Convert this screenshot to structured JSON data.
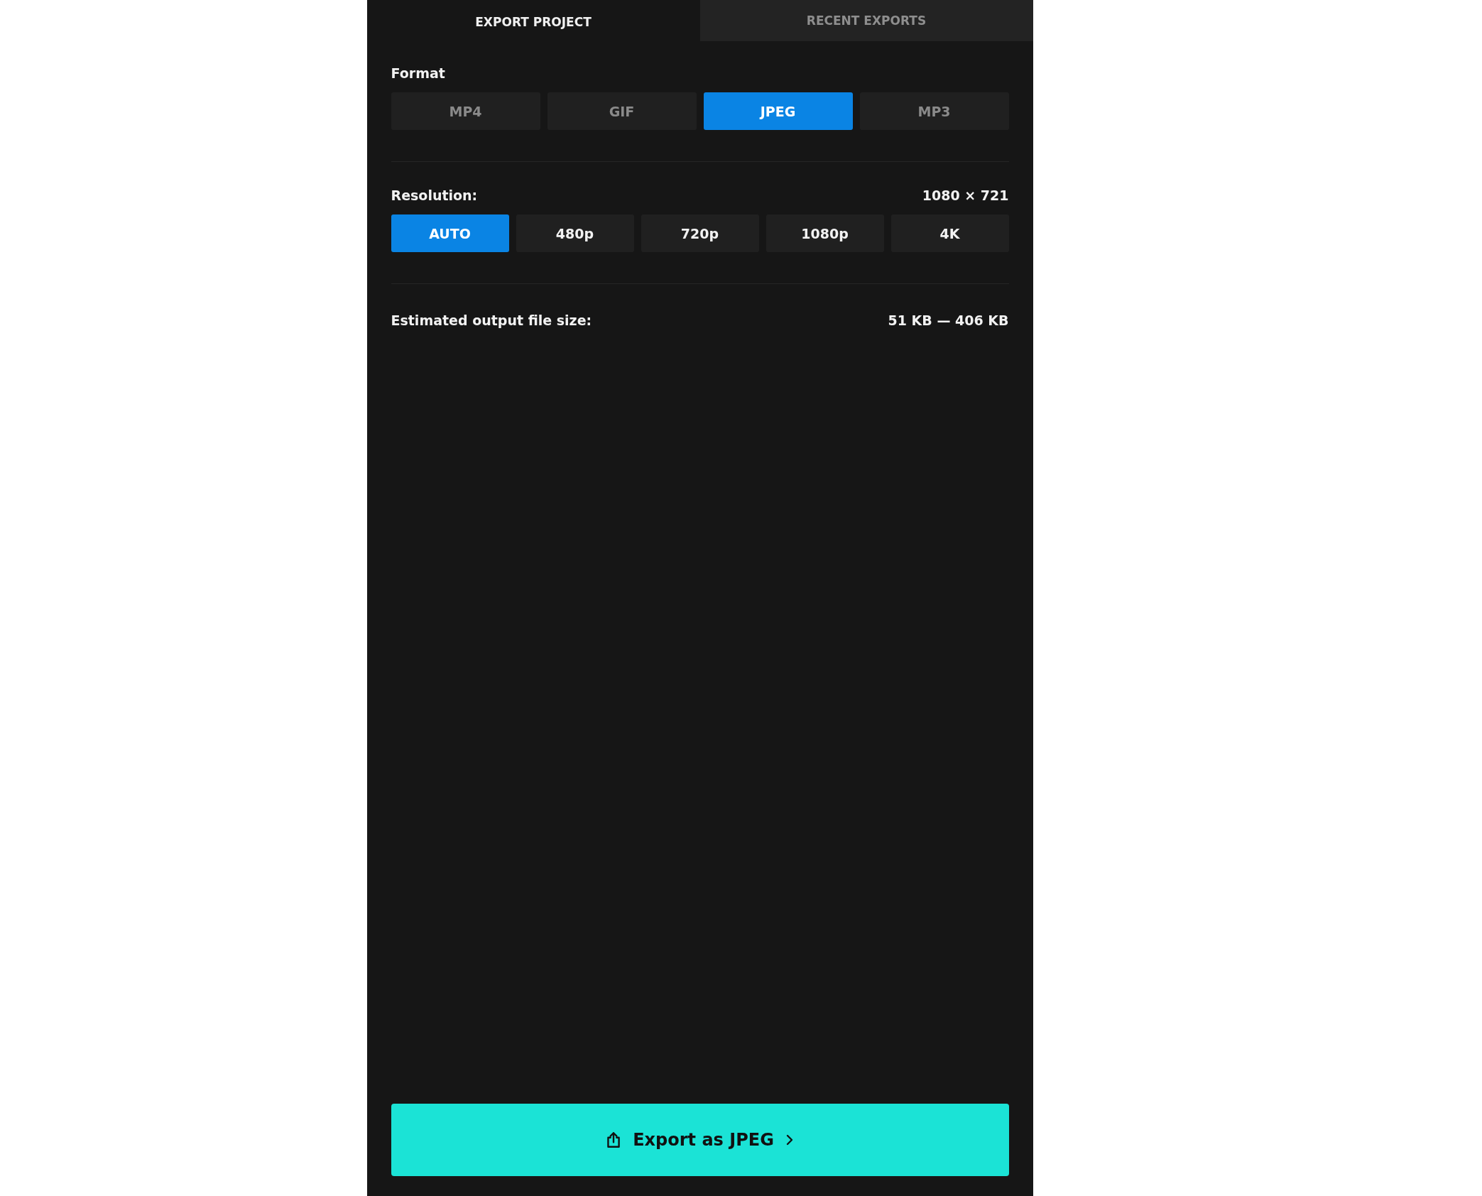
{
  "tabs": [
    {
      "label": "EXPORT PROJECT",
      "selected": true
    },
    {
      "label": "RECENT EXPORTS",
      "selected": false
    }
  ],
  "format": {
    "label": "Format",
    "options": [
      {
        "label": "MP4",
        "selected": false
      },
      {
        "label": "GIF",
        "selected": false
      },
      {
        "label": "JPEG",
        "selected": true
      },
      {
        "label": "MP3",
        "selected": false
      }
    ]
  },
  "resolution": {
    "label": "Resolution:",
    "value": "1080 × 721",
    "options": [
      {
        "label": "AUTO",
        "selected": true
      },
      {
        "label": "480p",
        "selected": false
      },
      {
        "label": "720p",
        "selected": false
      },
      {
        "label": "1080p",
        "selected": false
      },
      {
        "label": "4K",
        "selected": false
      }
    ]
  },
  "estimate": {
    "label": "Estimated output file size:",
    "value": "51 KB — 406 KB"
  },
  "export_button": {
    "label": "Export as JPEG"
  }
}
